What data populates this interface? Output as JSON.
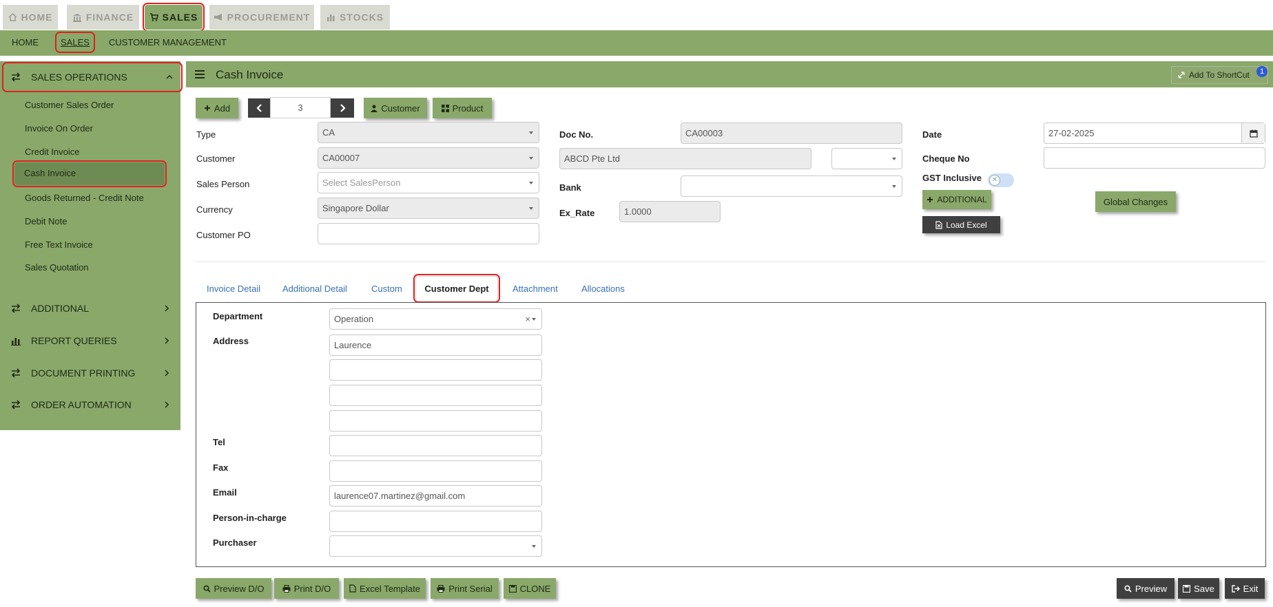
{
  "top_tabs": [
    {
      "label": "HOME",
      "icon": "home-icon"
    },
    {
      "label": "FINANCE",
      "icon": "bank-icon"
    },
    {
      "label": "SALES",
      "icon": "cart-icon"
    },
    {
      "label": "PROCUREMENT",
      "icon": "bullhorn-icon"
    },
    {
      "label": "STOCKS",
      "icon": "bar-chart-icon"
    }
  ],
  "sub_nav": [
    "HOME",
    "SALES",
    "CUSTOMER MANAGEMENT"
  ],
  "sidebar": {
    "sections": [
      {
        "label": "SALES OPERATIONS"
      },
      {
        "label": "ADDITIONAL"
      },
      {
        "label": "REPORT QUERIES"
      },
      {
        "label": "DOCUMENT PRINTING"
      },
      {
        "label": "ORDER AUTOMATION"
      }
    ],
    "items": [
      "Customer Sales Order",
      "Invoice On Order",
      "Credit Invoice",
      "Cash Invoice",
      "Goods Returned - Credit Note",
      "Debit Note",
      "Free Text Invoice",
      "Sales Quotation"
    ]
  },
  "header": {
    "title": "Cash Invoice",
    "shortcut_label": "Add To ShortCut",
    "shortcut_badge": "1"
  },
  "toolbar": {
    "add": "Add",
    "counter": "3",
    "customer": "Customer",
    "product": "Product"
  },
  "form": {
    "type_label": "Type",
    "type_value": "CA",
    "customer_label": "Customer",
    "customer_value": "CA00007",
    "sales_person_label": "Sales Person",
    "sales_person_placeholder": "Select SalesPerson",
    "currency_label": "Currency",
    "currency_value": "Singapore Dollar",
    "customer_po_label": "Customer PO",
    "customer_po_value": "",
    "doc_no_label": "Doc No.",
    "doc_no_value": "CA00003",
    "customer_name_value": "ABCD Pte Ltd",
    "bank_label": "Bank",
    "bank_value": "",
    "ex_rate_label": "Ex_Rate",
    "ex_rate_value": "1.0000",
    "date_label": "Date",
    "date_value": "27-02-2025",
    "cheque_label": "Cheque No",
    "cheque_value": "",
    "gst_label": "GST Inclusive",
    "additional_button": "ADDITIONAL",
    "load_excel_button": "Load Excel",
    "global_changes_button": "Global Changes"
  },
  "tabs": [
    "Invoice Detail",
    "Additional Detail",
    "Custom",
    "Customer Dept",
    "Attachment",
    "Allocations"
  ],
  "customer_dept": {
    "department_label": "Department",
    "department_value": "Operation",
    "address_label": "Address",
    "address_lines": [
      "Laurence",
      "",
      "",
      ""
    ],
    "tel_label": "Tel",
    "tel_value": "",
    "fax_label": "Fax",
    "fax_value": "",
    "email_label": "Email",
    "email_value": "laurence07.martinez@gmail.com",
    "pic_label": "Person-in-charge",
    "pic_value": "",
    "purchaser_label": "Purchaser",
    "purchaser_value": ""
  },
  "bottom_buttons": {
    "preview_do": "Preview D/O",
    "print_do": "Print D/O",
    "excel_template": "Excel Template",
    "print_serial": "Print Serial",
    "clone": "CLONE",
    "preview": "Preview",
    "save": "Save",
    "exit": "Exit"
  },
  "colors": {
    "accent_green": "#89a86a",
    "dark_button": "#3f3f3f",
    "highlight_red": "#e02020",
    "link_blue": "#3671b5"
  }
}
